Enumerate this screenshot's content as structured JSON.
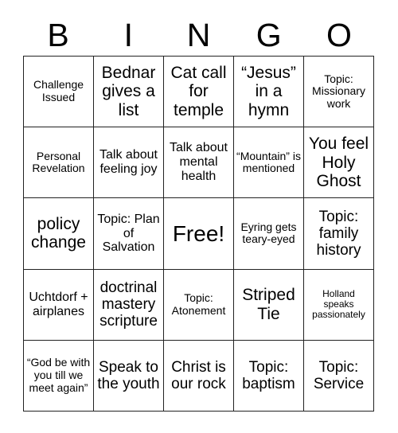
{
  "header": {
    "letters": [
      "B",
      "I",
      "N",
      "G",
      "O"
    ]
  },
  "grid": {
    "rows": 5,
    "columns": 5,
    "cells": [
      {
        "text": "Challenge Issued",
        "size": "sm"
      },
      {
        "text": "Bednar gives a list",
        "size": "xl"
      },
      {
        "text": "Cat call for temple",
        "size": "xl"
      },
      {
        "text": "“Jesus” in a hymn",
        "size": "xl"
      },
      {
        "text": "Topic: Missionary work",
        "size": "sm"
      },
      {
        "text": "Personal Revelation",
        "size": "sm"
      },
      {
        "text": "Talk about feeling joy",
        "size": "md"
      },
      {
        "text": "Talk about mental health",
        "size": "md"
      },
      {
        "text": "“Mountain” is mentioned",
        "size": "sm"
      },
      {
        "text": "You feel Holy Ghost",
        "size": "xl"
      },
      {
        "text": "policy change",
        "size": "xl"
      },
      {
        "text": "Topic: Plan of Salvation",
        "size": "md"
      },
      {
        "text": "Free!",
        "size": "xxl"
      },
      {
        "text": "Eyring gets teary-eyed",
        "size": "sm"
      },
      {
        "text": "Topic: family history",
        "size": "lg"
      },
      {
        "text": "Uchtdorf + airplanes",
        "size": "md"
      },
      {
        "text": "doctrinal mastery scripture",
        "size": "lg"
      },
      {
        "text": "Topic: Atonement",
        "size": "sm"
      },
      {
        "text": "Striped Tie",
        "size": "xl"
      },
      {
        "text": "Holland speaks passionately",
        "size": "xs"
      },
      {
        "text": "“God be with you till we meet again”",
        "size": "sm"
      },
      {
        "text": "Speak to the youth",
        "size": "lg"
      },
      {
        "text": "Christ is our rock",
        "size": "lg"
      },
      {
        "text": "Topic: baptism",
        "size": "lg"
      },
      {
        "text": "Topic: Service",
        "size": "lg"
      }
    ]
  },
  "colors": {
    "background": "#ffffff",
    "text": "#000000",
    "grid_border": "#222222"
  }
}
